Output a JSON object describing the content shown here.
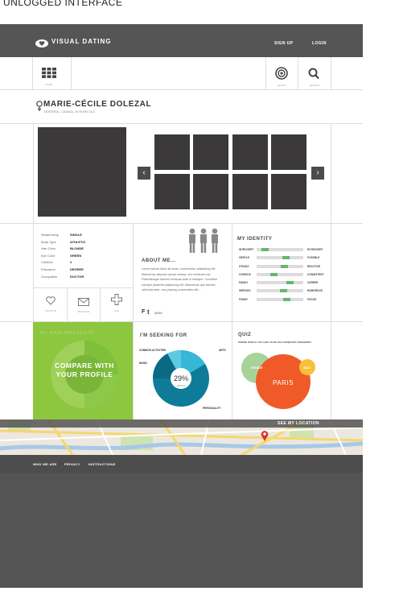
{
  "caption": "UNLOGGED INTERFACE",
  "header": {
    "brand": "VISUAL DATING",
    "signup": "SIGN UP",
    "login": "LOGIN",
    "home_label": "HOME",
    "radar_label": "RADAR",
    "search_label": "SEARCH"
  },
  "profile": {
    "name": "MARIE-CÉCILE DOLEZAL",
    "subtitle": "MONTREAL, CANADA, 26 YEARS OLD"
  },
  "details": [
    {
      "label": "Relationship",
      "value": "SINGLE"
    },
    {
      "label": "Body Type",
      "value": "ATHLETIC"
    },
    {
      "label": "Hair Color",
      "value": "BLONDE"
    },
    {
      "label": "Eye Color",
      "value": "GREEN"
    },
    {
      "label": "Children",
      "value": "2"
    },
    {
      "label": "Education",
      "value": "DEGREE"
    },
    {
      "label": "Occupation",
      "value": "DOCTOR"
    }
  ],
  "actions": {
    "favorite": "FAVORITE",
    "message": "MESSAGE",
    "add": "ADD"
  },
  "about": {
    "title": "ABOUT ME...",
    "text": "Lorem ipsum dolor sit amet, consectetur adipiscing elit. Maecenas aliquam ipsum massa, nec vehicula ma. Pellentesque laoreet vehicula ante in tristique. Curabitur rutrique pharetra adipiscing elit. Maecenas que laoreet vehicula ante, nec placing consectetur elit...",
    "social_f": "F",
    "social_t": "t",
    "social_count": "@Sell"
  },
  "identity": {
    "title": "MY IDENTITY",
    "rows": [
      {
        "left": "INTROVERT",
        "right": "EXTROVERT",
        "value": 0.12
      },
      {
        "left": "GENTLE",
        "right": "FLEXIBLE",
        "value": 0.65
      },
      {
        "left": "STEADY",
        "right": "REACTIVE",
        "value": 0.62
      },
      {
        "left": "CURIOUS",
        "right": "CONSISTENT",
        "value": 0.35
      },
      {
        "left": "FAMILY",
        "right": "CAREER",
        "value": 0.75
      },
      {
        "left": "SERIOUS",
        "right": "HUMOROUS",
        "value": 0.6
      },
      {
        "left": "FUNNY",
        "right": "FOCUS",
        "value": 0.68
      }
    ]
  },
  "interests": {
    "title": "MY MAIN INTERESTS",
    "compare": "COMPARE WITH YOUR PROFILE"
  },
  "seeking": {
    "title": "I'M SEEKING FOR",
    "percent": "29%",
    "center_sub": "MATCH",
    "label_1": "COMMON ACTIVITIES",
    "label_2": "ARTS",
    "label_3": "MUSIC",
    "label_4": "PERSONALITY"
  },
  "quiz": {
    "title": "QUIZ",
    "question": "WHERE WOULD YOU LIKE TO BE ON A ROMANTIC WEEKEND?",
    "bubble_1": "VENICE",
    "bubble_2": "PARIS",
    "bubble_3": "BALI"
  },
  "map": {
    "see_location": "SEE MY LOCATION"
  },
  "footer": {
    "who": "WHO WE ARE",
    "privacy": "PRIVACY",
    "instructions": "INSTRUCTIONS"
  },
  "colors": {
    "dark_bar": "#555555",
    "green_panel": "#8dc63f",
    "teal": "#0e7c99",
    "orange": "#f05a28",
    "bar_accent": "#66b66a"
  }
}
